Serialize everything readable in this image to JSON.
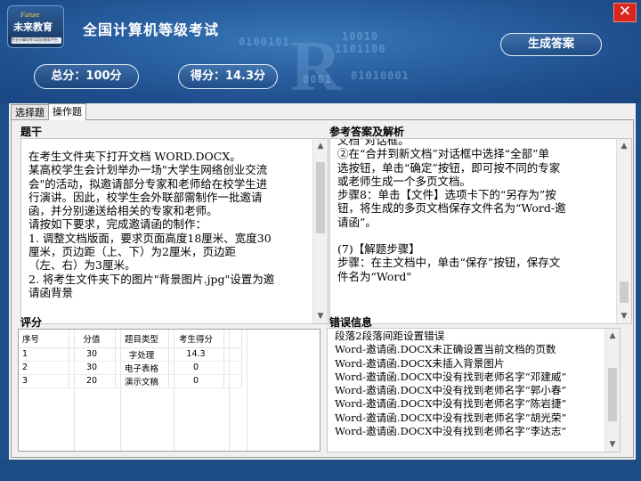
{
  "header": {
    "title": "全国计算机等级考试",
    "logo_en": "Future",
    "logo_cn": "未来教育",
    "logo_sub": "专业计算机考试培训服务平台",
    "total_label": "总分：100分",
    "score_label": "得分：14.3分",
    "generate_button": "生成答案",
    "close_glyph": "✕",
    "bg_digits": [
      "0100101",
      "1101100",
      "10010",
      "0001",
      "01010001"
    ]
  },
  "tabs": [
    {
      "label": "选择题"
    },
    {
      "label": "操作题"
    }
  ],
  "question": {
    "section_label": "题干",
    "lines": [
      "在考生文件夹下打开文档 WORD.DOCX。",
      "某高校学生会计划举办一场\"大学生网络创业交流",
      "会\"的活动，拟邀请部分专家和老师给在校学生进",
      "行演讲。因此，校学生会外联部需制作一批邀请",
      "函，并分别递送给相关的专家和老师。",
      "请按如下要求，完成邀请函的制作：",
      "1. 调整文档版面，要求页面高度18厘米、宽度30",
      "厘米，页边距（上、下）为2厘米，页边距",
      "（左、右）为3厘米。",
      "2. 将考生文件夹下的图片\"背景图片.jpg\"设置为邀",
      "请函背景"
    ]
  },
  "answer": {
    "section_label": "参考答案及解析",
    "lines": [
      "文档\"对话框。",
      "②在“合并到新文档”对话框中选择“全部”单",
      "选按钮，单击“确定”按钮，即可按不同的专家",
      "或老师生成一个多页文档。",
      "步骤8：单击【文件】选项卡下的“另存为”按",
      "钮，将生成的多页文档保存文件名为“Word-邀",
      "请函”。",
      "",
      "(7)【解题步骤】",
      "步骤：在主文档中，单击“保存”按钮，保存文",
      "件名为“Word\""
    ]
  },
  "scoring": {
    "section_label": "评分",
    "columns": [
      "序号",
      "分值",
      "题目类型",
      "考生得分"
    ],
    "rows": [
      {
        "no": "1",
        "points": "30",
        "type": "字处理",
        "score": "14.3"
      },
      {
        "no": "2",
        "points": "30",
        "type": "电子表格",
        "score": "0"
      },
      {
        "no": "3",
        "points": "20",
        "type": "演示文稿",
        "score": "0"
      }
    ]
  },
  "errors": {
    "section_label": "错误信息",
    "items": [
      "段落2段落间距设置错误",
      "Word-邀请函.DOCX未正确设置当前文档的页数",
      "Word-邀请函.DOCX未插入背景图片",
      "Word-邀请函.DOCX中没有找到老师名字“邓建威”",
      "Word-邀请函.DOCX中没有找到老师名字“郭小春”",
      "Word-邀请函.DOCX中没有找到老师名字“陈岩捷”",
      "Word-邀请函.DOCX中没有找到老师名字“胡光荣”",
      "Word-邀请函.DOCX中没有找到老师名字“李达志”"
    ]
  },
  "colors": {
    "header_bg": "#2a62a3",
    "close_bg": "#d9261c",
    "panel_bg": "#f0f0f0"
  }
}
